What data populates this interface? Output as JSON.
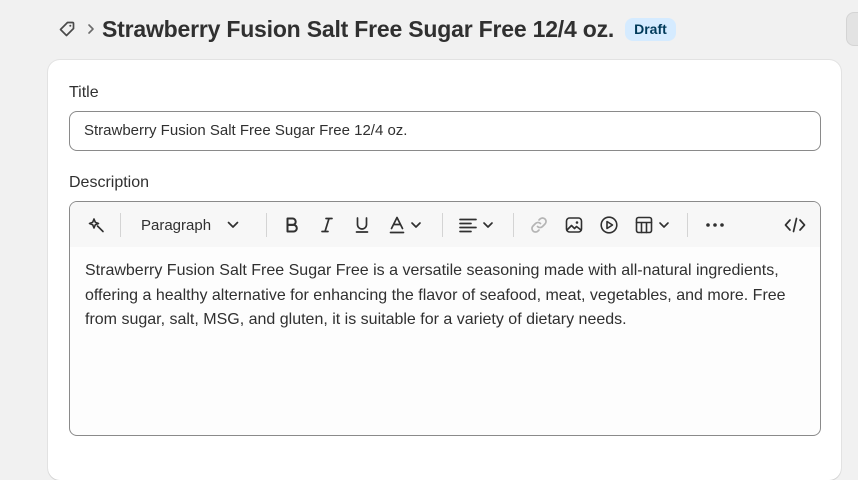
{
  "header": {
    "title": "Strawberry Fusion Salt Free Sugar Free 12/4 oz.",
    "status_badge": "Draft"
  },
  "form": {
    "title_label": "Title",
    "title_value": "Strawberry Fusion Salt Free Sugar Free 12/4 oz.",
    "description_label": "Description",
    "toolbar": {
      "block_format": "Paragraph",
      "icons": [
        "magic-icon",
        "bold-icon",
        "italic-icon",
        "underline-icon",
        "text-color-icon",
        "align-icon",
        "link-icon",
        "image-icon",
        "video-icon",
        "table-icon",
        "more-icon",
        "code-icon"
      ]
    },
    "description_value": "Strawberry Fusion Salt Free Sugar Free is a versatile seasoning made with all-natural ingredients, offering a healthy alternative for enhancing the flavor of seafood, meat, vegetables, and more. Free from sugar, salt, MSG, and gluten, it is suitable for a variety of dietary needs."
  },
  "colors": {
    "badge_bg": "#d5ebff",
    "badge_text": "#003a5a",
    "page_bg": "#f1f1f1",
    "card_bg": "#ffffff"
  }
}
